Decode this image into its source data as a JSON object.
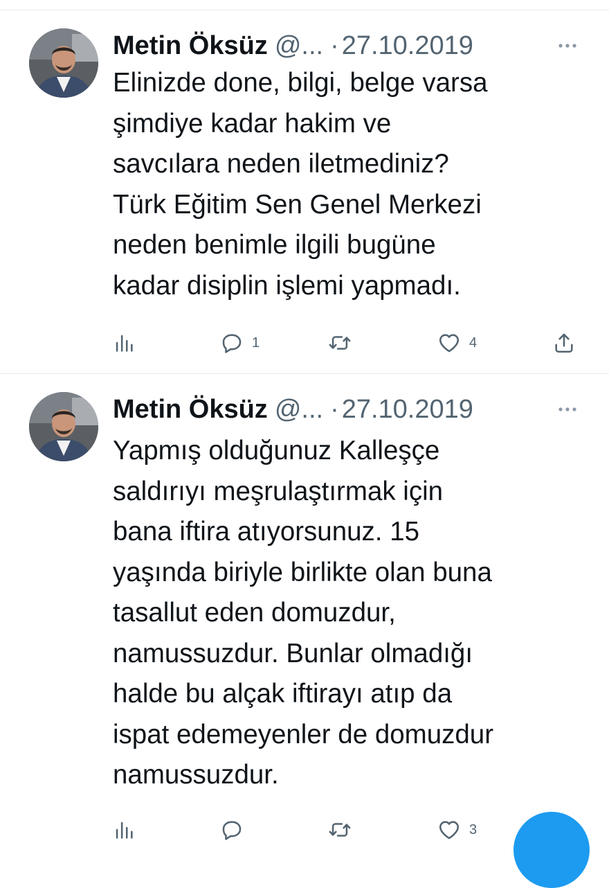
{
  "tweets": [
    {
      "author_name": "Metin Öksüz",
      "handle": "@...",
      "separator": "·",
      "date": "27.10.2019",
      "text": "Elinizde done, bilgi, belge varsa\nşimdiye kadar hakim ve\nsavcılara neden iletmediniz?\nTürk Eğitim Sen Genel Merkezi\nneden benimle ilgili bugüne\nkadar disiplin işlemi yapmadı.",
      "reply_count": "1",
      "like_count": "4"
    },
    {
      "author_name": "Metin Öksüz",
      "handle": "@...",
      "separator": "·",
      "date": "27.10.2019",
      "text": "Yapmış olduğunuz Kalleşçe\nsaldırıyı meşrulaştırmak için\nbana iftira atıyorsunuz. 15\nyaşında biriyle birlikte olan buna\ntasallut eden domuzdur,\nnamussuzdur. Bunlar olmadığı\nhalde bu alçak iftirayı atıp da\nispat edemeyenler de domuzdur\nnamussuzdur.",
      "reply_count": "",
      "like_count": "3"
    }
  ],
  "icons": {
    "analytics": "analytics-icon",
    "reply": "reply-icon",
    "retweet": "retweet-icon",
    "like": "heart-icon",
    "share": "share-icon",
    "more": "more-icon"
  },
  "colors": {
    "text": "#0f1419",
    "secondary": "#536471",
    "divider": "#e6e9ec",
    "accent": "#1d9bf0"
  }
}
